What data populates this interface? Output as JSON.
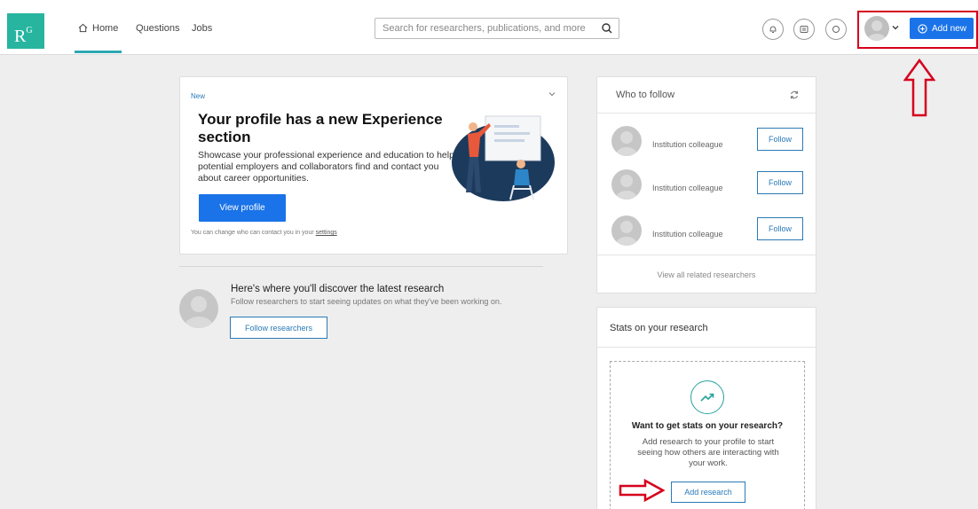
{
  "logo": {
    "letter": "R",
    "sup": "G"
  },
  "nav": {
    "home": "Home",
    "questions": "Questions",
    "jobs": "Jobs"
  },
  "search": {
    "placeholder": "Search for researchers, publications, and more"
  },
  "header": {
    "add_new": "Add new"
  },
  "promo": {
    "badge": "New",
    "title": "Your profile has a new Experience section",
    "description": "Showcase your professional experience and education to help potential employers and collaborators find and contact you about career opportunities.",
    "button": "View profile",
    "note_prefix": "You can change who can contact you in your",
    "note_link": "settings"
  },
  "discover": {
    "title": "Here's where you'll discover the latest research",
    "subtitle": "Follow researchers to start seeing updates on what they've been working on.",
    "button": "Follow researchers"
  },
  "who_to_follow": {
    "title": "Who to follow",
    "items": [
      {
        "name": "Institution colleague",
        "button": "Follow"
      },
      {
        "name": "Institution colleague",
        "button": "Follow"
      },
      {
        "name": "Institution colleague",
        "button": "Follow"
      }
    ],
    "view_all": "View all related researchers"
  },
  "stats": {
    "title": "Stats on your research",
    "heading": "Want to get stats on your research?",
    "description": "Add research to your profile to start seeing how others are interacting with your work.",
    "button": "Add research"
  },
  "colors": {
    "brand": "#27b5a0",
    "primary": "#1a73e8",
    "link": "#2a7ab7",
    "annotation": "#d6001c"
  }
}
